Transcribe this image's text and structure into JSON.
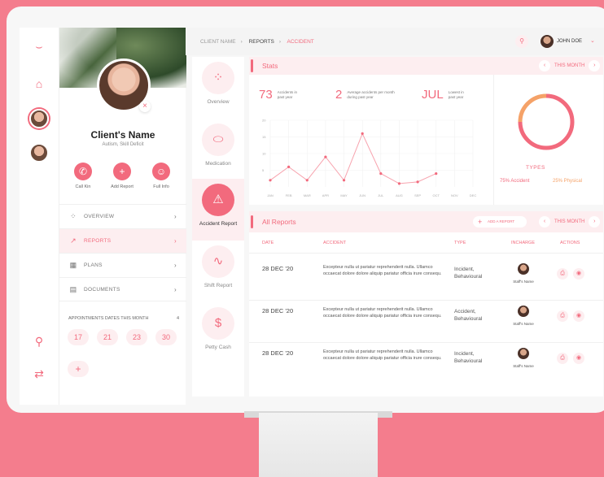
{
  "colors": {
    "accent": "#f26a7d",
    "accent_soft": "#fdeef0",
    "orange": "#f5a268",
    "background": "#f47d8d"
  },
  "rail": {
    "icons": [
      "logo-icon",
      "home-icon",
      "search-icon",
      "sync-icon"
    ]
  },
  "profile": {
    "name": "Client's Name",
    "subtitle": "Autism, Skill Deficit",
    "actions": [
      {
        "label": "Call Kin",
        "icon": "phone-icon"
      },
      {
        "label": "Add Report",
        "icon": "plus-icon"
      },
      {
        "label": "Full Info",
        "icon": "user-icon"
      }
    ],
    "menu": [
      {
        "label": "OVERVIEW",
        "icon": "spinner-icon",
        "active": false
      },
      {
        "label": "REPORTS",
        "icon": "trend-icon",
        "active": true
      },
      {
        "label": "PLANS",
        "icon": "calendar-icon",
        "active": false
      },
      {
        "label": "DOCUMENTS",
        "icon": "document-icon",
        "active": false
      }
    ],
    "appointments_title": "APPOINTMENTS DATES THIS MONTH",
    "appointments_count": "4",
    "dates": [
      "17",
      "21",
      "23",
      "30"
    ]
  },
  "topbar": {
    "breadcrumb": [
      "CLIENT NAME",
      "REPORTS",
      "ACCIDENT"
    ],
    "user": "JOHN DOE"
  },
  "nav": [
    {
      "label": "Overview",
      "icon": "spinner-icon"
    },
    {
      "label": "Medication",
      "icon": "pill-icon"
    },
    {
      "label": "Accident Report",
      "icon": "warning-icon"
    },
    {
      "label": "Shift Report",
      "icon": "pulse-icon"
    },
    {
      "label": "Petty Cash",
      "icon": "dollar-icon"
    }
  ],
  "stats": {
    "title": "Stats",
    "period": "THIS MONTH",
    "kpis": [
      {
        "value": "73",
        "text": "Accidents in past year"
      },
      {
        "value": "2",
        "text": "Average accidents per month during past year"
      },
      {
        "value": "JUL",
        "text": "Lowest in past year"
      }
    ],
    "donut_label": "TYPES",
    "legend": [
      "75% Accident",
      "25% Physical"
    ]
  },
  "chart_data": {
    "type": "line",
    "categories": [
      "JAN",
      "FEB",
      "MAR",
      "APR",
      "MAY",
      "JUN",
      "JUL",
      "AUG",
      "SEP",
      "OCT",
      "NOV",
      "DEC"
    ],
    "y_ticks": [
      "20",
      "15",
      "10",
      "5"
    ],
    "ylim": [
      0,
      20
    ],
    "series": [
      {
        "values": [
          2,
          6,
          2,
          9,
          2,
          16,
          4,
          1,
          1.5,
          4,
          null,
          null
        ]
      }
    ],
    "donut": [
      {
        "value": 75
      },
      {
        "value": 25
      }
    ]
  },
  "reports": {
    "title": "All Reports",
    "period": "THIS MONTH",
    "add_label": "ADD A REPORT",
    "columns": [
      "DATE",
      "ACCIDENT",
      "TYPE",
      "INCHARGE",
      "ACTIONS"
    ],
    "rows": [
      {
        "date": "28 DEC '20",
        "desc": "Excepteur nulla ut pariatur reprehenderit nulla. Ullamco occaecat dolore dolore aliquip pariatur officia irure consequ.",
        "type": "Incident, Behavioural",
        "staff": "Staff's Name"
      },
      {
        "date": "28 DEC '20",
        "desc": "Excepteur nulla ut pariatur reprehenderit nulla. Ullamco occaecat dolore dolore aliquip pariatur officia irure consequ.",
        "type": "Accident, Behavioural",
        "staff": "Staff's Name"
      },
      {
        "date": "28 DEC '20",
        "desc": "Excepteur nulla ut pariatur reprehenderit nulla. Ullamco occaecat dolore dolore aliquip pariatur officia irure consequ.",
        "type": "Incident, Behavioural",
        "staff": "Staff's Name"
      }
    ]
  }
}
